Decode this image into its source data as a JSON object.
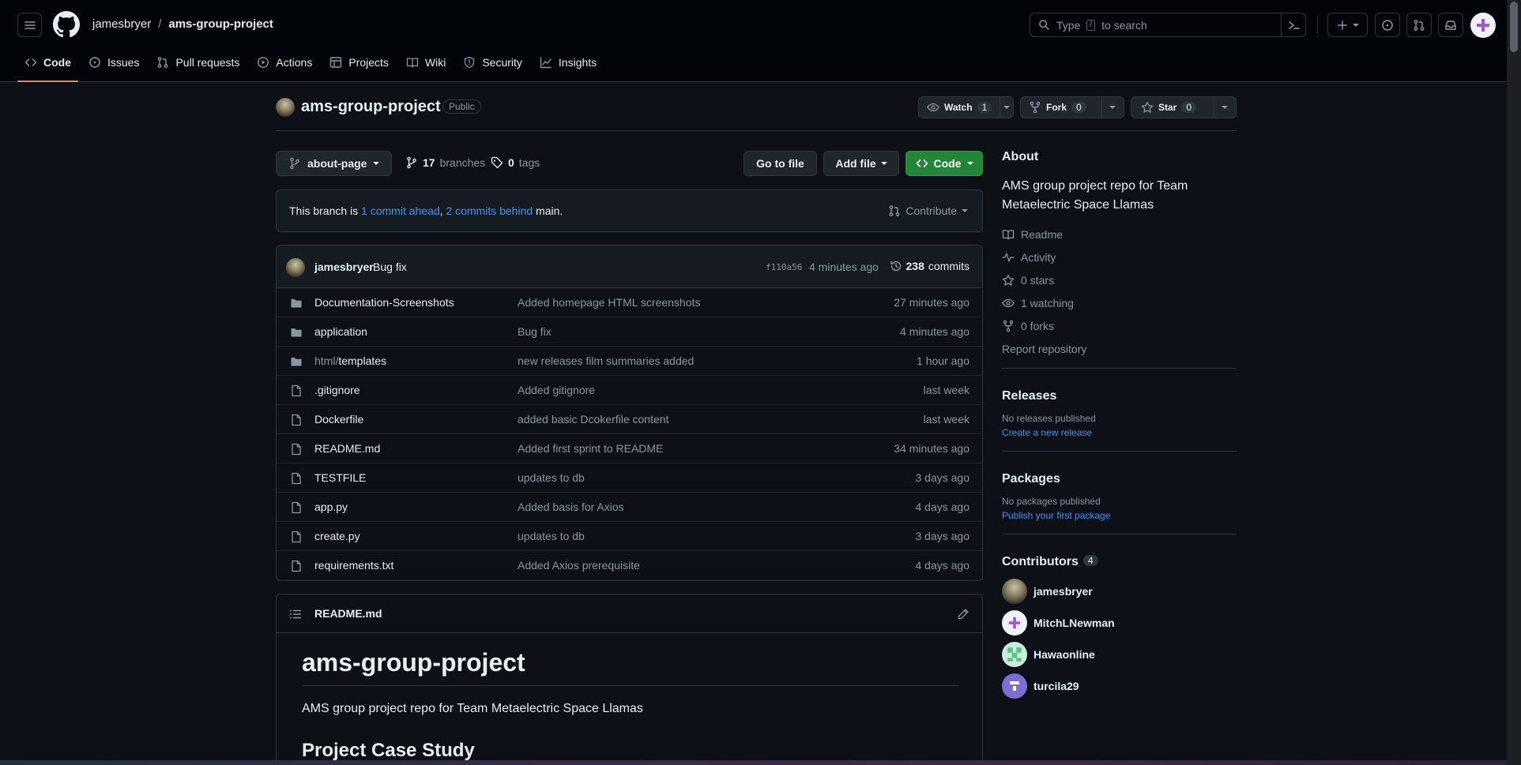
{
  "header": {
    "owner": "jamesbryer",
    "separator": "/",
    "repo": "ams-group-project",
    "search_placeholder_pre": "Type",
    "search_key": "/",
    "search_placeholder_post": "to search"
  },
  "nav": {
    "tabs": [
      {
        "label": "Code",
        "icon": "code-icon"
      },
      {
        "label": "Issues",
        "icon": "issue-icon"
      },
      {
        "label": "Pull requests",
        "icon": "pull-request-icon"
      },
      {
        "label": "Actions",
        "icon": "play-icon"
      },
      {
        "label": "Projects",
        "icon": "table-icon"
      },
      {
        "label": "Wiki",
        "icon": "book-icon"
      },
      {
        "label": "Security",
        "icon": "shield-icon"
      },
      {
        "label": "Insights",
        "icon": "graph-icon"
      }
    ]
  },
  "repo": {
    "title": "ams-group-project",
    "visibility": "Public",
    "watch_label": "Watch",
    "watch_count": "1",
    "fork_label": "Fork",
    "fork_count": "0",
    "star_label": "Star",
    "star_count": "0"
  },
  "filenav": {
    "branch": "about-page",
    "branches_count": "17",
    "branches_label": "branches",
    "tags_count": "0",
    "tags_label": "tags",
    "goto_file": "Go to file",
    "add_file": "Add file",
    "code": "Code"
  },
  "ahead": {
    "prefix": "This branch is",
    "ahead_link": "1 commit ahead",
    "comma": ",",
    "behind_link": "2 commits behind",
    "suffix": "main.",
    "contribute": "Contribute"
  },
  "latest_commit": {
    "author": "jamesbryer",
    "message": "Bug fix",
    "sha": "f110a56",
    "time": "4 minutes ago",
    "count": "238",
    "count_label": "commits"
  },
  "files": [
    {
      "type": "dir",
      "prefix": "",
      "name": "Documentation-Screenshots",
      "message": "Added homepage HTML screenshots",
      "time": "27 minutes ago"
    },
    {
      "type": "dir",
      "prefix": "",
      "name": "application",
      "message": "Bug fix",
      "time": "4 minutes ago"
    },
    {
      "type": "dir",
      "prefix": "html/",
      "name": "templates",
      "message": "new releases film summaries added",
      "time": "1 hour ago"
    },
    {
      "type": "file",
      "prefix": "",
      "name": ".gitignore",
      "message": "Added gitignore",
      "time": "last week"
    },
    {
      "type": "file",
      "prefix": "",
      "name": "Dockerfile",
      "message": "added basic Dcokerfile content",
      "time": "last week"
    },
    {
      "type": "file",
      "prefix": "",
      "name": "README.md",
      "message": "Added first sprint to README",
      "time": "34 minutes ago"
    },
    {
      "type": "file",
      "prefix": "",
      "name": "TESTFILE",
      "message": "updates to db",
      "time": "3 days ago"
    },
    {
      "type": "file",
      "prefix": "",
      "name": "app.py",
      "message": "Added basis for Axios",
      "time": "4 days ago"
    },
    {
      "type": "file",
      "prefix": "",
      "name": "create.py",
      "message": "updates to db",
      "time": "3 days ago"
    },
    {
      "type": "file",
      "prefix": "",
      "name": "requirements.txt",
      "message": "Added Axios prerequisite",
      "time": "4 days ago"
    }
  ],
  "readme": {
    "file": "README.md",
    "h1": "ams-group-project",
    "p": "AMS group project repo for Team Metaelectric Space Llamas",
    "h2": "Project Case Study"
  },
  "about": {
    "title": "About",
    "description": "AMS group project repo for Team Metaelectric Space Llamas",
    "readme": "Readme",
    "activity": "Activity",
    "stars": "0 stars",
    "watching": "1 watching",
    "forks": "0 forks",
    "report": "Report repository"
  },
  "releases": {
    "title": "Releases",
    "none": "No releases published",
    "create": "Create a new release"
  },
  "packages": {
    "title": "Packages",
    "none": "No packages published",
    "publish": "Publish your first package"
  },
  "contributors": {
    "title": "Contributors",
    "count": "4",
    "people": [
      {
        "name": "jamesbryer",
        "color": "#7a735a"
      },
      {
        "name": "MitchLNewman",
        "color": "#f0f0f5"
      },
      {
        "name": "Hawaonline",
        "color": "#c9ecd6"
      },
      {
        "name": "turcila29",
        "color": "#7b6fd6"
      }
    ]
  },
  "colors": {
    "accent_tab": "#f78166",
    "link": "#4493f8",
    "primary_button": "#238636",
    "background": "#0d1117",
    "header_background": "#010409"
  }
}
